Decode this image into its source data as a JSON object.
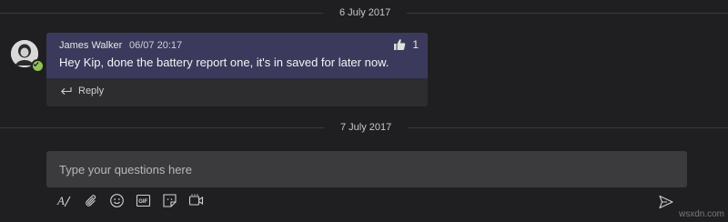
{
  "dividers": [
    "6 July 2017",
    "7 July 2017"
  ],
  "message": {
    "sender": "James Walker",
    "timestamp": "06/07 20:17",
    "text": "Hey Kip, done the battery report one, it's in saved for later now.",
    "like_count": "1",
    "reply_label": "Reply"
  },
  "compose": {
    "placeholder": "Type your questions here"
  },
  "toolbar": {
    "icons": [
      "format-icon",
      "attach-icon",
      "emoji-icon",
      "gif-icon",
      "sticker-icon",
      "meet-now-icon"
    ],
    "send_icon": "send-icon"
  },
  "watermark": "wsxdn.com",
  "colors": {
    "background": "#1f1f22",
    "message_bg": "#3b3a5c",
    "card_bg": "#2d2c2e",
    "compose_bg": "#3b3a3d",
    "presence": "#92c353"
  }
}
